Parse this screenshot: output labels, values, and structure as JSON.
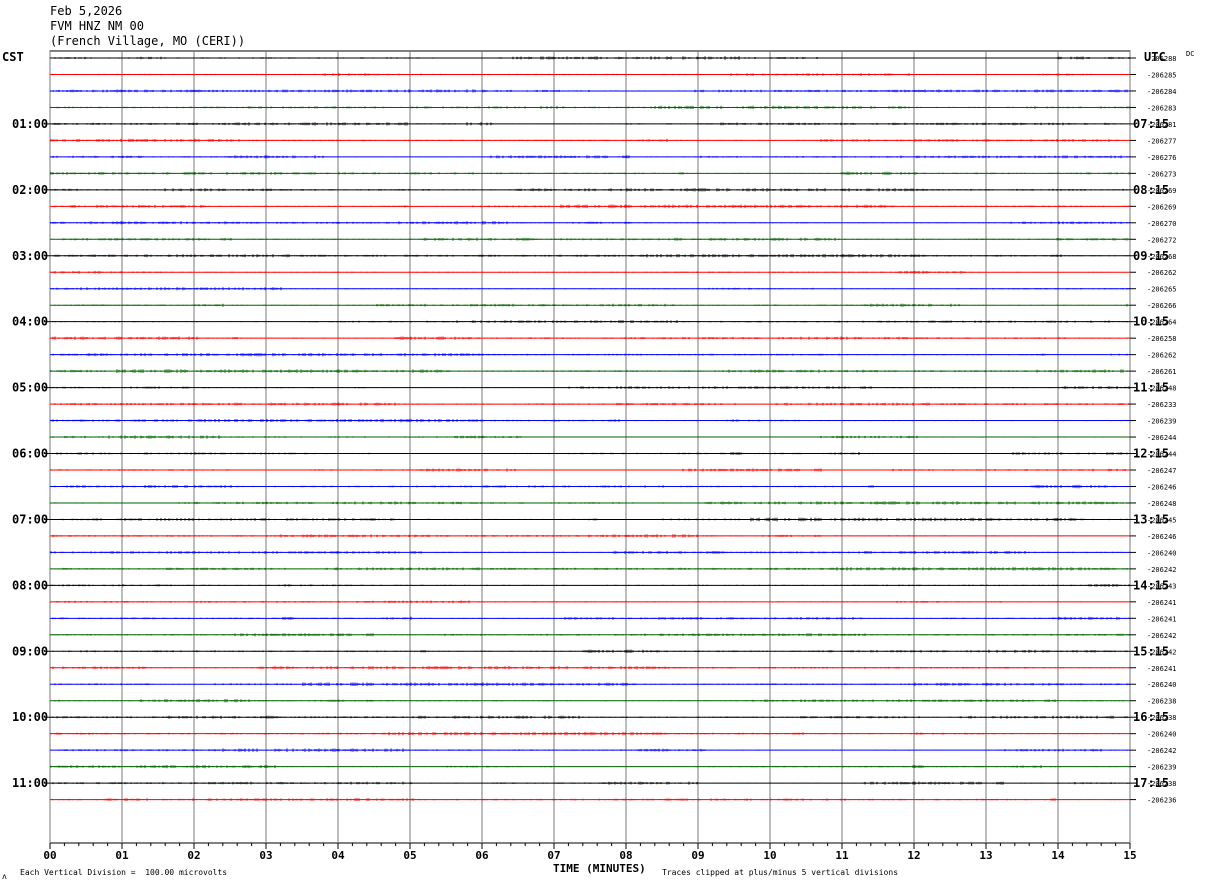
{
  "header": {
    "date": "Feb 5,2026",
    "station": "FVM HNZ NM 00",
    "location": "(French Village, MO (CERI))"
  },
  "left_corner_label": "CST",
  "right_corner_label": "UTC",
  "dc_label": "DC",
  "footer": {
    "scale_note": "Each Vertical Division =  100.00 microvolts",
    "clip_note": "Traces clipped at plus/minus 5 vertical divisions",
    "corner_mark": "ʌ"
  },
  "chart_data": {
    "type": "helicorder",
    "xlabel": "TIME (MINUTES)",
    "xlim": [
      0,
      15
    ],
    "x_ticks": [
      "00",
      "01",
      "02",
      "03",
      "04",
      "05",
      "06",
      "07",
      "08",
      "09",
      "10",
      "11",
      "12",
      "13",
      "14",
      "15"
    ],
    "trace_minutes": 15,
    "grid": true,
    "trace_colors": [
      "#000000",
      "#ff0000",
      "#0000ff",
      "#006400"
    ],
    "left_time_labels": [
      "01:00",
      "02:00",
      "03:00",
      "04:00",
      "05:00",
      "06:00",
      "07:00",
      "08:00",
      "09:00",
      "10:00",
      "11:00"
    ],
    "right_time_labels": [
      "07:15",
      "08:15",
      "09:15",
      "10:15",
      "11:15",
      "12:15",
      "13:15",
      "14:15",
      "15:15",
      "16:15",
      "17:15"
    ],
    "dc_offsets": [
      "-206288",
      "-206285",
      "-206284",
      "-206283",
      "-206281",
      "-206277",
      "-206276",
      "-206273",
      "-206269",
      "-206269",
      "-206270",
      "-206272",
      "-206268",
      "-206262",
      "-206265",
      "-206266",
      "-206264",
      "-206258",
      "-206262",
      "-206261",
      "-206248",
      "-206233",
      "-206239",
      "-206244",
      "-206244",
      "-206247",
      "-206246",
      "-206248",
      "-206245",
      "-206246",
      "-206240",
      "-206242",
      "-206243",
      "-206241",
      "-206241",
      "-206242",
      "-206242",
      "-206241",
      "-206240",
      "-206238",
      "-206238",
      "-206240",
      "-206242",
      "-206239",
      "-206238",
      "-206236"
    ]
  },
  "colors": {
    "grid": "#7a7a7a",
    "frame": "#000000"
  }
}
